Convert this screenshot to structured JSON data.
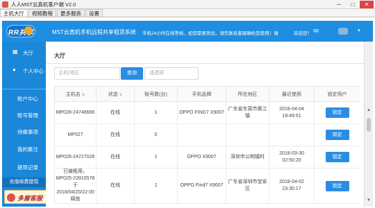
{
  "window": {
    "title": "人人MST云真机客户端 V2.0",
    "controls": {
      "minimize": "─",
      "maximize": "□",
      "close": "✕"
    }
  },
  "menu_tabs": [
    {
      "label": "主机大厅"
    },
    {
      "label": "视频教程"
    },
    {
      "label": "更多服务"
    },
    {
      "label": "设置"
    }
  ],
  "header": {
    "logo_text": "RR共享",
    "title": "MST云真机手机远程共享租赁系统",
    "notice": "手机24小时在线等候。如您需要测试，请先联系客服确检您使用！谢",
    "welcome": "欢迎您！",
    "user": "qq",
    "caret": "▾"
  },
  "sidebar": {
    "top_items": [
      {
        "icon": "grid-icon",
        "glyph": "▦",
        "label": "大厅"
      },
      {
        "icon": "user-icon",
        "glyph": "●",
        "label": "个人中心"
      }
    ],
    "links": [
      {
        "label": "账户中心"
      },
      {
        "label": "账号管理"
      },
      {
        "label": "待做事项"
      },
      {
        "label": "我的集注"
      },
      {
        "label": "提现记录"
      }
    ],
    "bottom": "充值续费提现",
    "brand": "多屋客服"
  },
  "main": {
    "title": "大厅",
    "search_placeholder": "主机/地区",
    "search_button": "查询",
    "select_placeholder": "请选择",
    "columns": [
      "主机名",
      "状态",
      "账号数(台)",
      "手机品牌",
      "所在地区",
      "最近使用",
      "锁定用户"
    ],
    "sort_mark": "⇅",
    "rows": [
      {
        "name": "MP028-24748666",
        "status": "在线",
        "count": "1",
        "brand": "OPPO FIND7 X9007",
        "region": "广东省东莞市黄江镇",
        "last_used": "2018-04-04 19:49:51",
        "action": "锁定"
      },
      {
        "name": "MP027",
        "status": "在线",
        "count": "0",
        "brand": "",
        "region": "",
        "last_used": "",
        "action": "锁定"
      },
      {
        "name": "MP026-24727028",
        "status": "在线",
        "count": "1",
        "brand": "OPPO X9007",
        "region": "深圳市公明镇村",
        "last_used": "2018-03-30 02:50:20",
        "action": "锁定"
      },
      {
        "name": "已被租用，MP025-23915578于2018/04/20/22:00释放",
        "status": "在线",
        "count": "1",
        "brand": "OPPO Find7 X9007",
        "region": "广东省深圳市宝安区",
        "last_used": "2018-04-02 23:30:17",
        "action": "锁定"
      }
    ]
  },
  "colors": {
    "header_blue": "#1f8de0",
    "sidebar_blue": "#1a87d8",
    "button_blue": "#2a8de4",
    "close_red": "#e04343"
  }
}
